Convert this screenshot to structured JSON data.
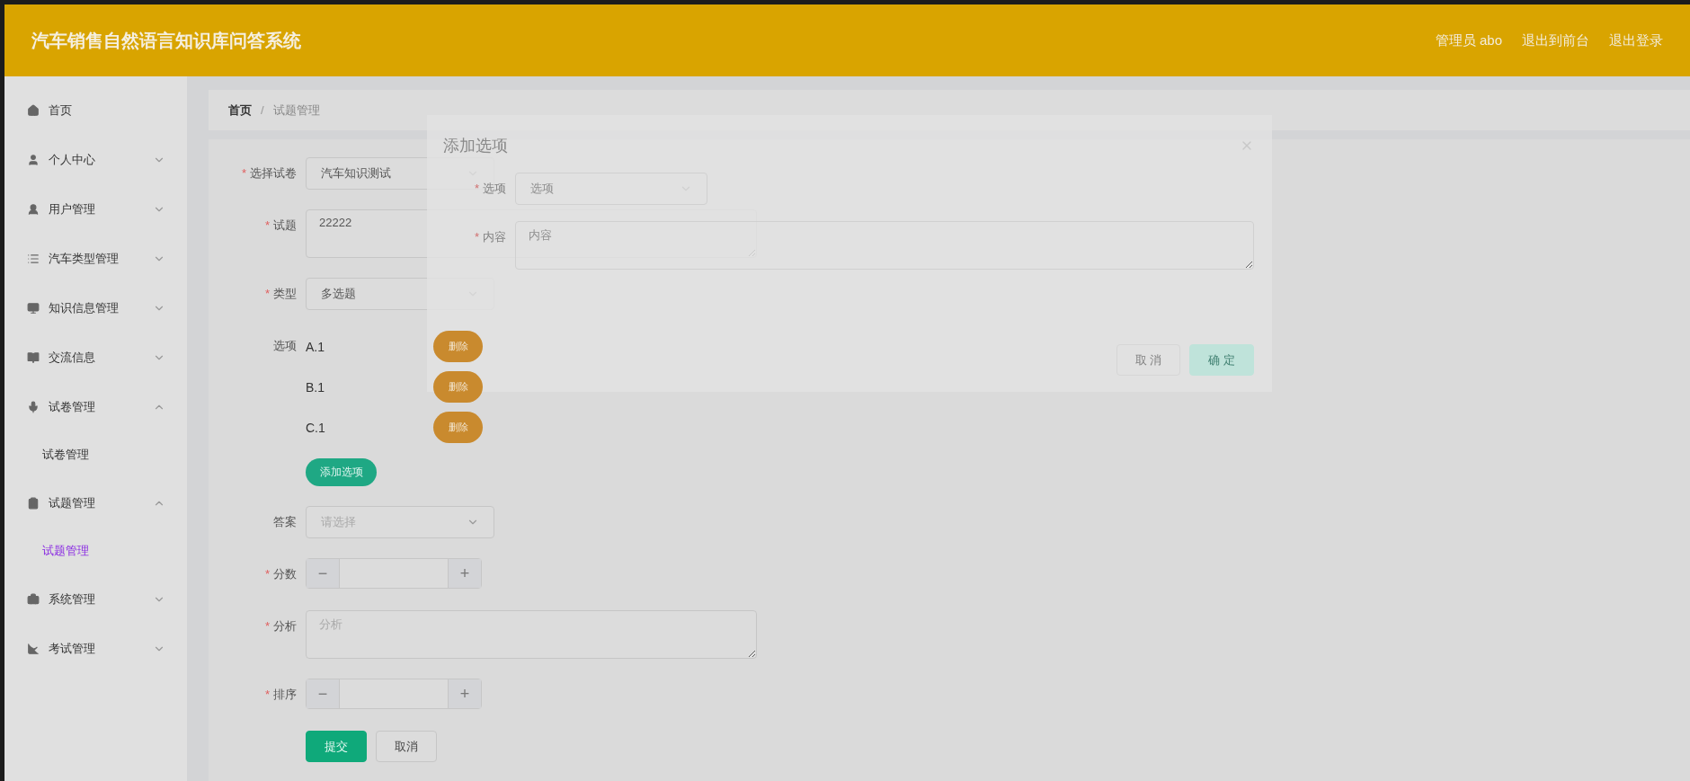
{
  "header": {
    "title": "汽车销售自然语言知识库问答系统",
    "user": "管理员 abo",
    "links": [
      "退出到前台",
      "退出登录"
    ]
  },
  "sidebar": {
    "items": [
      {
        "label": "首页",
        "kind": "link"
      },
      {
        "label": "个人中心",
        "kind": "menu",
        "expanded": false
      },
      {
        "label": "用户管理",
        "kind": "menu",
        "expanded": false
      },
      {
        "label": "汽车类型管理",
        "kind": "menu",
        "expanded": false
      },
      {
        "label": "知识信息管理",
        "kind": "menu",
        "expanded": false
      },
      {
        "label": "交流信息",
        "kind": "menu",
        "expanded": false
      },
      {
        "label": "试卷管理",
        "kind": "menu",
        "expanded": true,
        "children": [
          {
            "label": "试卷管理",
            "selected": false
          }
        ]
      },
      {
        "label": "试题管理",
        "kind": "menu",
        "expanded": true,
        "children": [
          {
            "label": "试题管理",
            "selected": true
          }
        ]
      },
      {
        "label": "系统管理",
        "kind": "menu",
        "expanded": false
      },
      {
        "label": "考试管理",
        "kind": "menu",
        "expanded": false
      }
    ]
  },
  "breadcrumb": {
    "items": [
      "首页",
      "试题管理"
    ],
    "separator": "/"
  },
  "form": {
    "fields": [
      {
        "label": "选择试卷",
        "required_mark": "*",
        "kind": "select",
        "value": "汽车知识测试"
      },
      {
        "label": "试题",
        "required_mark": "*",
        "kind": "textarea",
        "value": "22222"
      },
      {
        "label": "类型",
        "required_mark": "*",
        "kind": "select",
        "value": "多选题"
      },
      {
        "label": "选项",
        "kind": "options",
        "options": [
          {
            "text": "A.1",
            "button": "删除"
          },
          {
            "text": "B.1",
            "button": "删除"
          },
          {
            "text": "C.1",
            "button": "删除"
          }
        ],
        "add_button": "添加选项"
      },
      {
        "label": "答案",
        "kind": "select",
        "placeholder": "请选择"
      },
      {
        "label": "分数",
        "required_mark": "*",
        "kind": "number",
        "minus": "−",
        "plus": "+"
      },
      {
        "label": "分析",
        "required_mark": "*",
        "kind": "textarea",
        "placeholder": "分析"
      },
      {
        "label": "排序",
        "required_mark": "*",
        "kind": "number",
        "minus": "−",
        "plus": "+"
      }
    ],
    "buttons": [
      "提交",
      "取消"
    ]
  },
  "dialog": {
    "title": "添加选项",
    "fields": [
      {
        "label": "选项",
        "required_mark": "*",
        "kind": "select",
        "placeholder": "选项"
      },
      {
        "label": "内容",
        "required_mark": "*",
        "kind": "textarea",
        "placeholder": "内容"
      }
    ],
    "buttons": [
      "取 消",
      "确 定"
    ]
  }
}
